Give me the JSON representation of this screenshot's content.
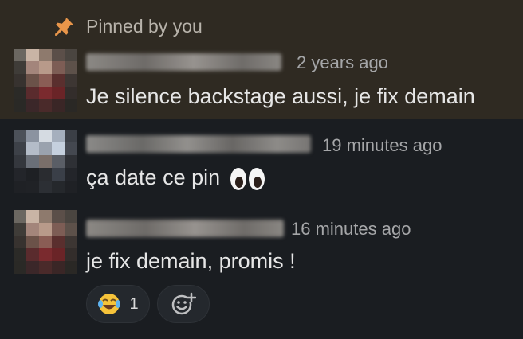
{
  "pinned": {
    "label": "Pinned by you",
    "icon": "pushpin-icon"
  },
  "messages": [
    {
      "timestamp": "2 years ago",
      "text": "Je silence backstage aussi, je fix demain",
      "pinned": true
    },
    {
      "timestamp": "19 minutes ago",
      "text": "ça date ce pin",
      "emoji": "eyes-emoji"
    },
    {
      "timestamp": "16 minutes ago",
      "text": "je fix demain, promis !",
      "reactions": [
        {
          "emoji": "joy-emoji",
          "count": "1"
        }
      ],
      "add_reaction_icon": "add-emoji-icon"
    }
  ],
  "colors": {
    "background": "#1a1d21",
    "pinned_background": "#2f2a22",
    "pin_accent": "#e8954a",
    "timestamp": "#a5a6a8",
    "message_text": "#e6e6e6"
  }
}
